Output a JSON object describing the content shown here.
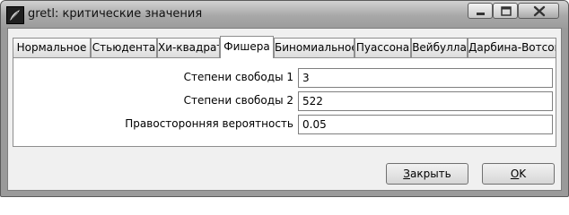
{
  "window": {
    "title": "gretl: критические значения"
  },
  "tabs": [
    {
      "label": "Нормальное",
      "active": false
    },
    {
      "label": "Стьюдента",
      "active": false
    },
    {
      "label": "Хи-квадрат",
      "active": false
    },
    {
      "label": "Фишера",
      "active": true
    },
    {
      "label": "Биномиальное",
      "active": false
    },
    {
      "label": "Пуассона",
      "active": false
    },
    {
      "label": "Вейбулла",
      "active": false
    },
    {
      "label": "Дарбина-Вотсона",
      "active": false
    }
  ],
  "form": {
    "df1": {
      "label": "Степени свободы 1",
      "value": "3"
    },
    "df2": {
      "label": "Степени свободы 2",
      "value": "522"
    },
    "prob": {
      "label": "Правосторонняя вероятность",
      "value": "0.05"
    }
  },
  "buttons": {
    "close_mnemonic": "З",
    "close_rest": "акрыть",
    "ok_mnemonic": "O",
    "ok_rest": "K"
  }
}
